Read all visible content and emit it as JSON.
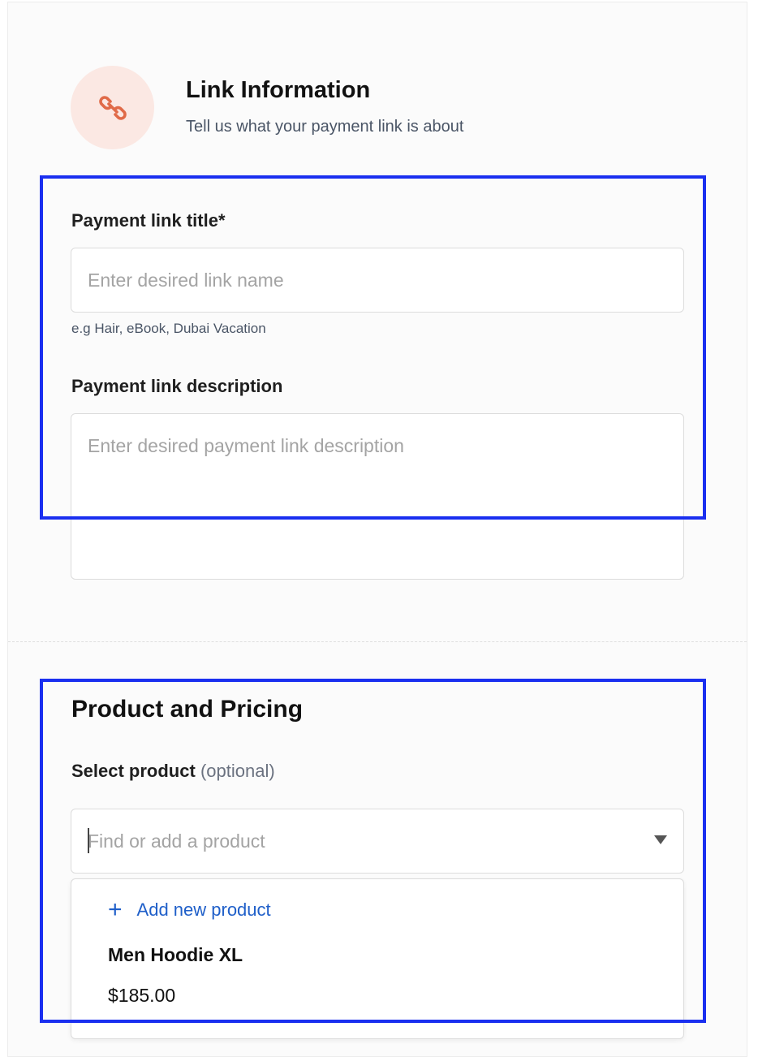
{
  "link_info": {
    "heading": "Link Information",
    "subheading": "Tell us what your payment link is about",
    "icon": "link-icon"
  },
  "title_field": {
    "label": "Payment link title*",
    "placeholder": "Enter desired link name",
    "value": "",
    "hint": "e.g Hair, eBook, Dubai Vacation"
  },
  "description_field": {
    "label": "Payment link description",
    "placeholder": "Enter desired payment link description",
    "value": ""
  },
  "product_pricing": {
    "heading": "Product and Pricing",
    "select_label": "Select product",
    "select_optional": "(optional)",
    "search_placeholder": "Find or add a product",
    "add_new_label": "Add new product",
    "products": [
      {
        "name": "Men Hoodie XL",
        "price": "$185.00"
      }
    ]
  },
  "colors": {
    "accent_link": "#1f5fc9",
    "icon_bg": "#fbe8e3",
    "icon_fg": "#e06a48",
    "highlight_border": "#1a2ff0"
  }
}
